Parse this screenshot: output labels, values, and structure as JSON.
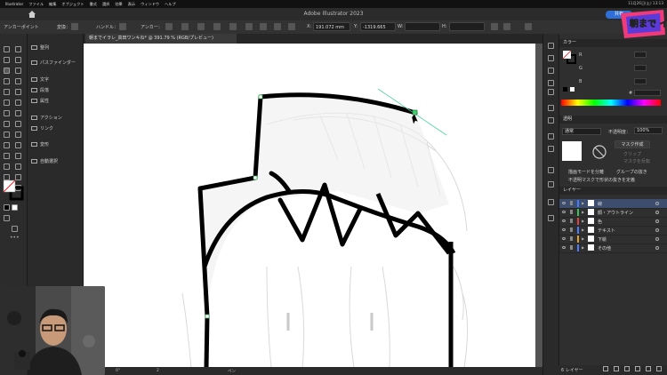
{
  "menubar": {
    "items": [
      "Illustrator",
      "ファイル",
      "編集",
      "オブジェクト",
      "書式",
      "選択",
      "効果",
      "表示",
      "ウィンドウ",
      "ヘルプ"
    ],
    "clock": "11月26日(土) 13:13"
  },
  "window": {
    "title": "Adobe Illustrator 2023",
    "share_label": "共有"
  },
  "control_bar": {
    "mode_label": "アンカーポイント",
    "convert_label": "変換：",
    "handle_label": "ハンドル：",
    "anchor_label": "アンカー：",
    "x_label": "X:",
    "x_value": "191.072 mm",
    "y_label": "Y:",
    "y_value": "-1319.665",
    "w_label": "W:",
    "h_label": "H:"
  },
  "panel_dock": {
    "items": [
      {
        "label": "整列",
        "icon": "align-icon"
      },
      {
        "label": "パスファインダー",
        "icon": "pathfinder-icon"
      },
      {
        "label": "文字",
        "icon": "character-icon"
      },
      {
        "label": "段落",
        "icon": "paragraph-icon"
      },
      {
        "label": "属性",
        "icon": "attributes-icon"
      },
      {
        "label": "アクション",
        "icon": "actions-icon"
      },
      {
        "label": "リンク",
        "icon": "links-icon"
      },
      {
        "label": "変形",
        "icon": "transform-icon"
      },
      {
        "label": "自動選択",
        "icon": "magic-wand-icon"
      }
    ]
  },
  "document": {
    "tab_title": "朝までイラレ_高田ワンキね* @ 391.79 % (RGB/プレビュー)",
    "status_zoom": "391.79%",
    "status_angle": "0°",
    "status_page": "2",
    "status_tool": "ペン"
  },
  "color_panel": {
    "title": "カラー",
    "channels": [
      "R",
      "G",
      "B"
    ],
    "hex_prefix": "#"
  },
  "transparency_panel": {
    "title": "透明",
    "blend_mode": "通常",
    "opacity_label": "不透明度：",
    "opacity_value": "100%",
    "make_mask": "マスク作成",
    "clip_label": "クリップ",
    "invert_label": "マスクを反転",
    "isolate_label": "描画モードを分離",
    "knockout_label": "グループの抜き",
    "opacity_mask_label": "不透明マスクで形状の抜きを定義"
  },
  "layers_panel": {
    "title": "レイヤー",
    "layers": [
      {
        "name": "線",
        "color": "#4a7bff",
        "selected": true
      },
      {
        "name": "顔・アウトライン",
        "color": "#3cc15a",
        "selected": false
      },
      {
        "name": "色",
        "color": "#e04040",
        "selected": false
      },
      {
        "name": "テキスト",
        "color": "#4a7bff",
        "selected": false
      },
      {
        "name": "下絵",
        "color": "#e0a030",
        "selected": false
      },
      {
        "name": "その他",
        "color": "#4a7bff",
        "selected": false
      }
    ],
    "footer": "6 レイヤー"
  },
  "logo": {
    "text": "朝まで イラレ"
  },
  "colors": {
    "accent": "#2f6fd8",
    "path_stroke": "#000000",
    "anchor": "#3cd06a"
  }
}
